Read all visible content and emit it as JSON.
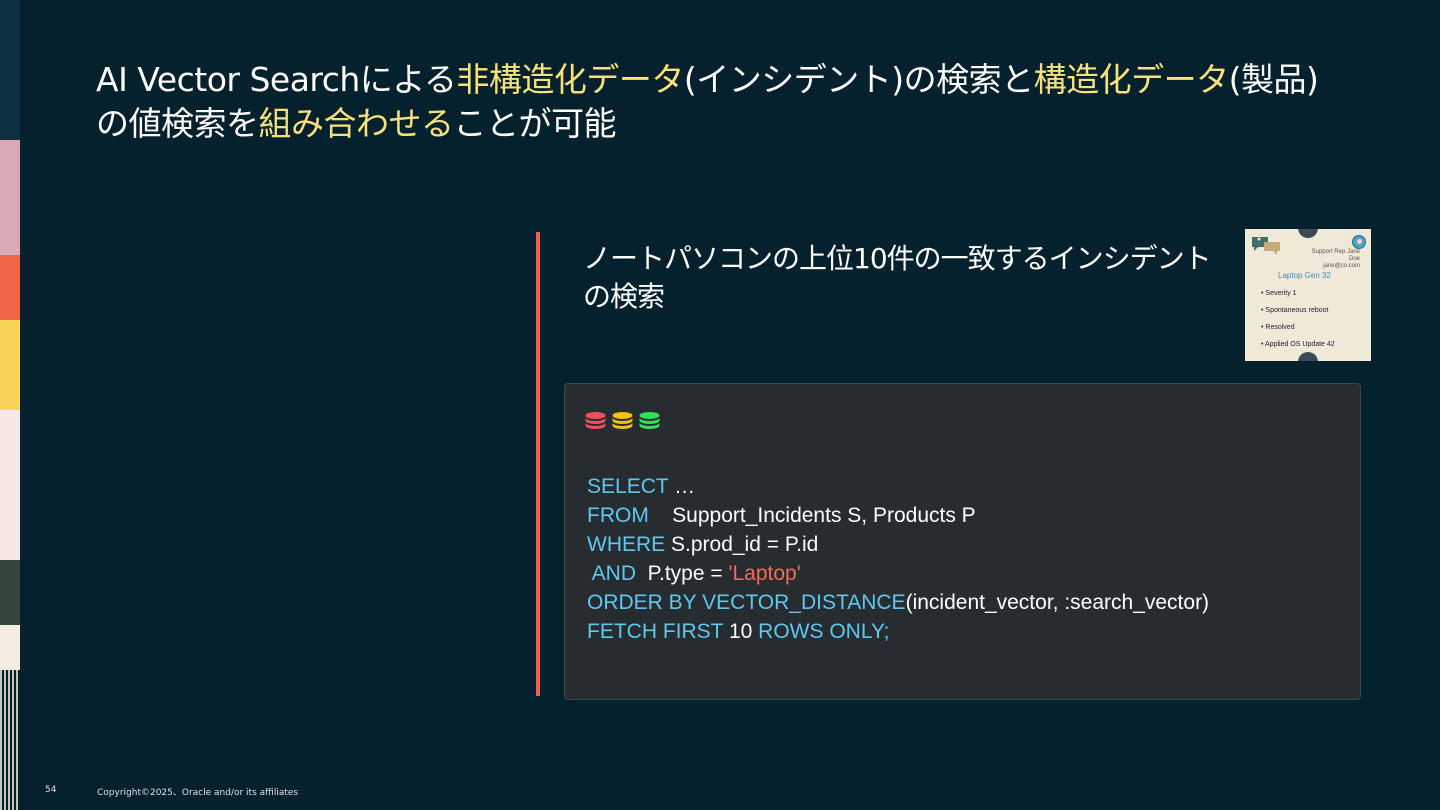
{
  "title": {
    "part1": "AI Vector Searchによる",
    "hl1": "非構造化データ",
    "part2": "(インシデント)の検索と",
    "hl2": "構造化データ",
    "part3": "(製品)",
    "part4": "の値検索を",
    "hl3": "組み合わせる",
    "part5": "ことが可能"
  },
  "subtitle": {
    "line1": "ノートパソコンの上位10件の一致するインシデント",
    "line2": "の検索"
  },
  "incident_card": {
    "rep": "Support Rep Jane Doe",
    "email": "jane@co.com",
    "product": "Laptop Gen 32",
    "items": [
      "Severity 1",
      "Spontaneous reboot",
      "Resolved",
      "Applied OS Update 42"
    ]
  },
  "code": {
    "db_icon_colors": [
      "#f0505a",
      "#f2c018",
      "#2ee05a"
    ],
    "select_kw": "SELECT",
    "select_rest": " …",
    "from_kw": "FROM",
    "from_rest": "    Support_Incidents S, Products P",
    "where_kw": "WHERE",
    "where_rest": " S.prod_id = P.id",
    "and_kw": " AND",
    "and_rest": "  P.type = ",
    "and_str": "'Laptop'",
    "order_kw": "ORDER BY VECTOR_DISTANCE",
    "order_rest": "(incident_vector, :search_vector)",
    "fetch_kw": "FETCH FIRST",
    "fetch_num": " 10 ",
    "fetch_kw2": "ROWS ONLY;"
  },
  "footer": {
    "page_number": "54",
    "copyright": "Copyright©2025、Oracle and/or its affiliates"
  }
}
